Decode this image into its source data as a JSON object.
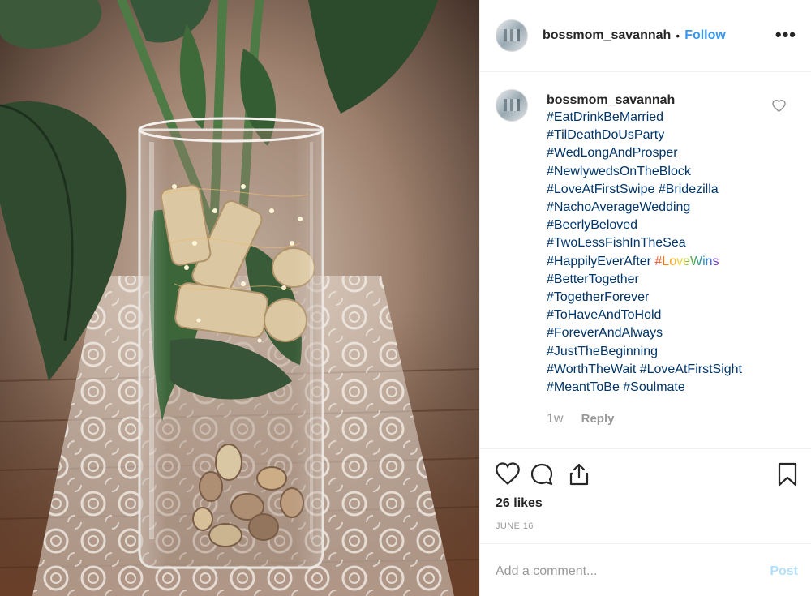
{
  "post": {
    "image_alt": "Glass vase with wine corks, stones, greenery and string lights on a lace table runner"
  },
  "header": {
    "username": "bossmom_savannah",
    "separator": "•",
    "follow_label": "Follow",
    "more_label": "•••"
  },
  "caption": {
    "username": "bossmom_savannah",
    "hashtags": [
      "#EatDrinkBeMarried",
      "#TilDeathDoUsParty",
      "#WedLongAndProsper",
      "#NewlywedsOnTheBlock",
      "#LoveAtFirstSwipe #Bridezilla",
      "#NachoAverageWedding",
      "#BeerlyBeloved",
      "#TwoLessFishInTheSea"
    ],
    "happily": "#HappilyEverAfter",
    "lovewins": "#LoveWins",
    "hashtags_after": [
      "#BetterTogether",
      "#TogetherForever",
      "#ToHaveAndToHold",
      "#ForeverAndAlways",
      "#JustTheBeginning",
      "#WorthTheWait #LoveAtFirstSight",
      "#MeantToBe #Soulmate"
    ],
    "time": "1w",
    "reply_label": "Reply"
  },
  "stats": {
    "likes": "26 likes",
    "date": "JUNE 16"
  },
  "comment_box": {
    "placeholder": "Add a comment...",
    "post_label": "Post"
  },
  "colors": {
    "link": "#003569",
    "follow": "#3897f0",
    "post_disabled": "#b2dffc",
    "muted": "#999999"
  },
  "icons": [
    "heart-icon",
    "comment-icon",
    "share-icon",
    "bookmark-icon",
    "small-heart-icon",
    "more-icon"
  ]
}
